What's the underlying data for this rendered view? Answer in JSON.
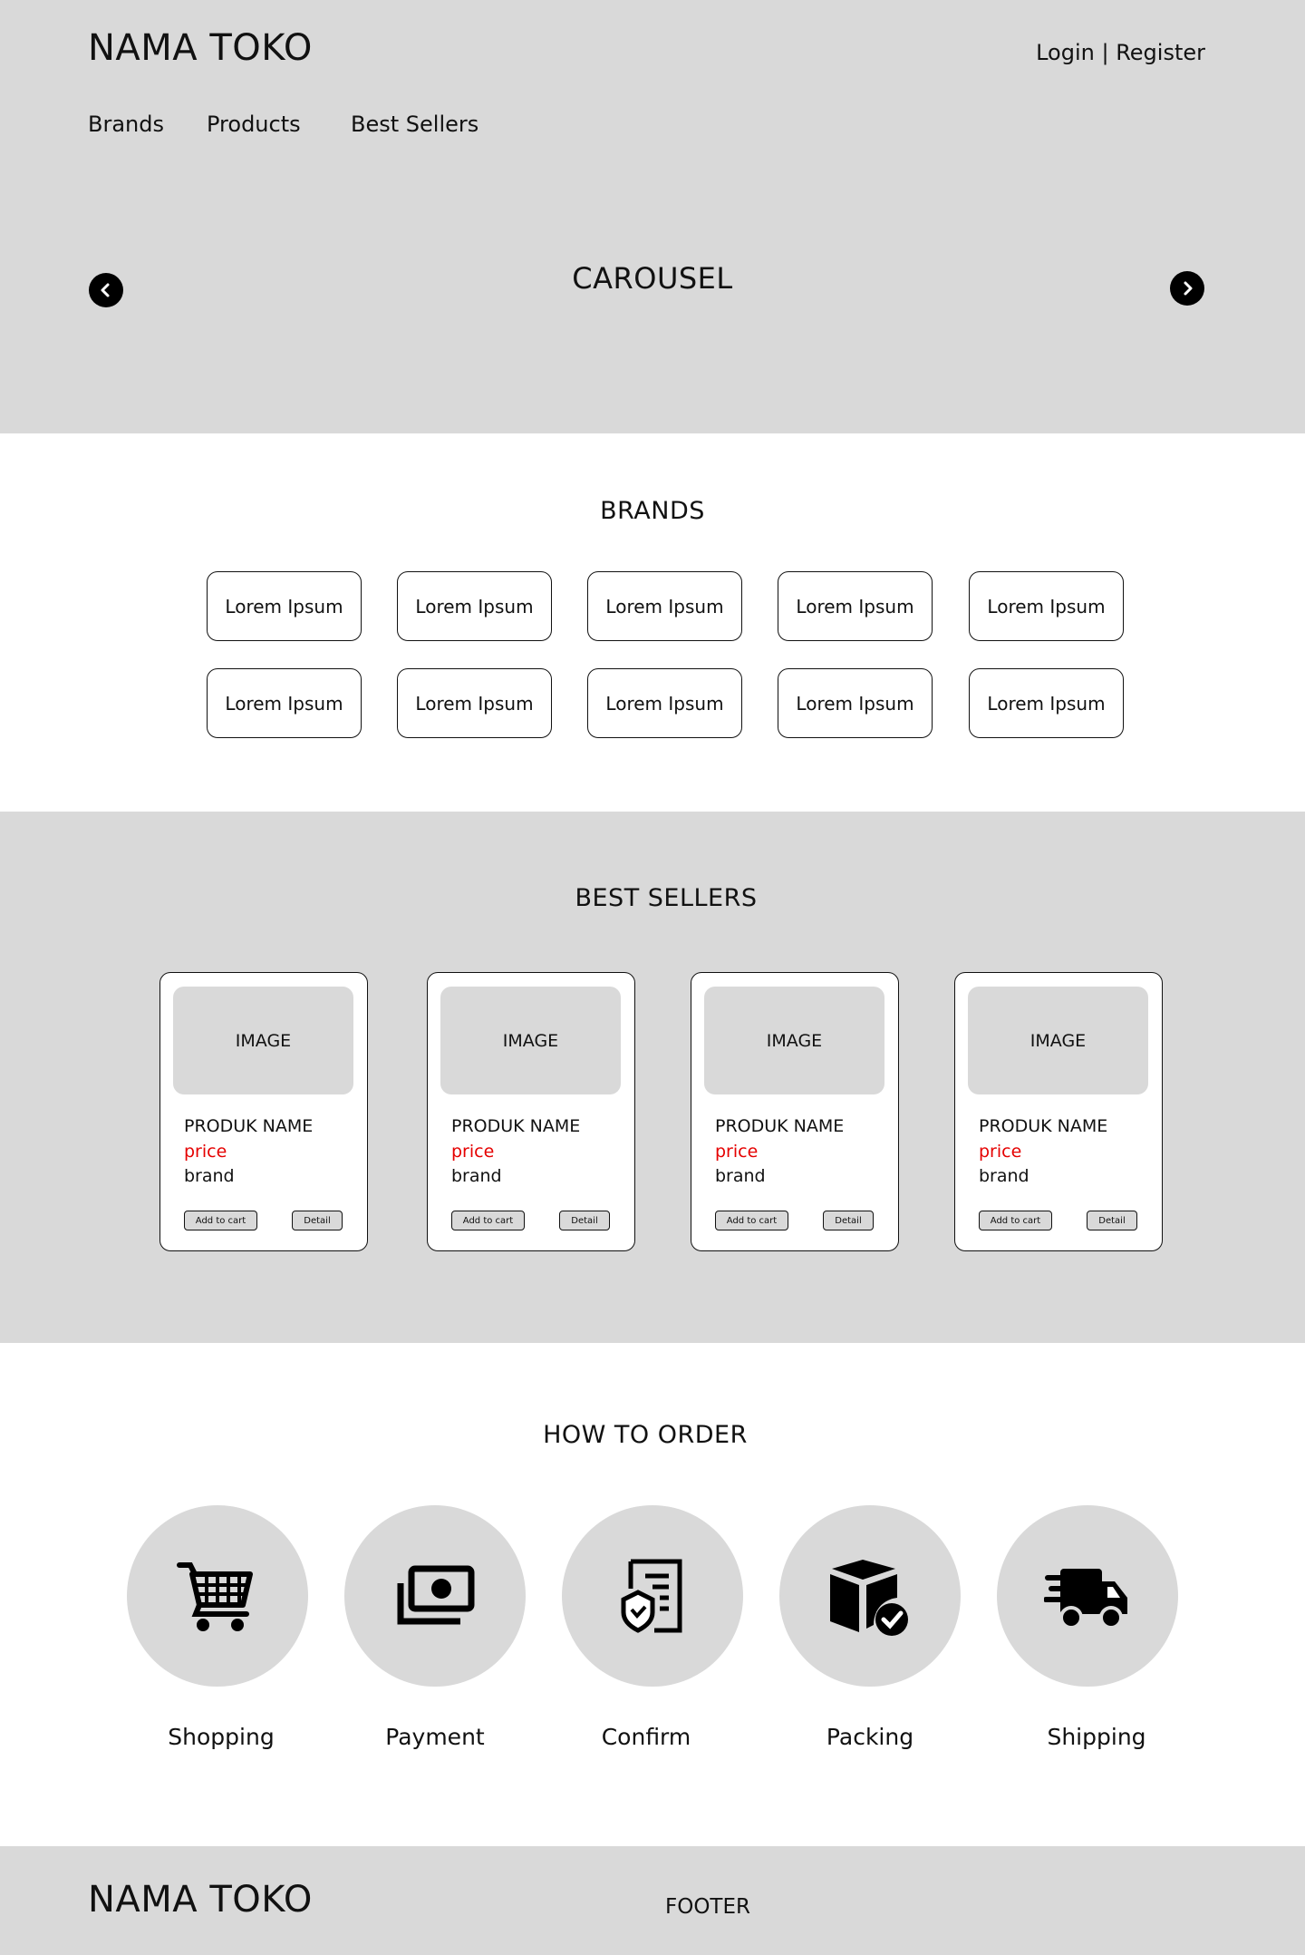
{
  "header": {
    "logo": "NAMA TOKO",
    "login_label": "Login",
    "separator": " | ",
    "register_label": "Register",
    "nav": [
      {
        "label": "Brands"
      },
      {
        "label": "Products"
      },
      {
        "label": "Best Sellers"
      }
    ]
  },
  "carousel": {
    "title": "CAROUSEL",
    "prev_icon": "chevron-left-icon",
    "next_icon": "chevron-right-icon"
  },
  "brands": {
    "title": "BRANDS",
    "items": [
      {
        "label": "Lorem Ipsum"
      },
      {
        "label": "Lorem Ipsum"
      },
      {
        "label": "Lorem Ipsum"
      },
      {
        "label": "Lorem Ipsum"
      },
      {
        "label": "Lorem Ipsum"
      },
      {
        "label": "Lorem Ipsum"
      },
      {
        "label": "Lorem Ipsum"
      },
      {
        "label": "Lorem Ipsum"
      },
      {
        "label": "Lorem Ipsum"
      },
      {
        "label": "Lorem Ipsum"
      }
    ]
  },
  "bestsellers": {
    "title": "BEST SELLERS",
    "cards": [
      {
        "image": "IMAGE",
        "name": "PRODUK NAME",
        "price": "price",
        "brand": "brand",
        "add_label": "Add to cart",
        "detail_label": "Detail"
      },
      {
        "image": "IMAGE",
        "name": "PRODUK NAME",
        "price": "price",
        "brand": "brand",
        "add_label": "Add to cart",
        "detail_label": "Detail"
      },
      {
        "image": "IMAGE",
        "name": "PRODUK NAME",
        "price": "price",
        "brand": "brand",
        "add_label": "Add to cart",
        "detail_label": "Detail"
      },
      {
        "image": "IMAGE",
        "name": "PRODUK NAME",
        "price": "price",
        "brand": "brand",
        "add_label": "Add to cart",
        "detail_label": "Detail"
      }
    ],
    "price_color": "#e50000"
  },
  "howto": {
    "title": "HOW TO ORDER",
    "steps": [
      {
        "label": "Shopping",
        "icon": "shopping-cart-icon"
      },
      {
        "label": "Payment",
        "icon": "money-icon"
      },
      {
        "label": "Confirm",
        "icon": "document-shield-icon"
      },
      {
        "label": "Packing",
        "icon": "package-check-icon"
      },
      {
        "label": "Shipping",
        "icon": "delivery-truck-icon"
      }
    ]
  },
  "footer": {
    "logo": "NAMA TOKO",
    "text": "FOOTER"
  },
  "colors": {
    "panel_gray": "#d9d9d9",
    "text": "#111111",
    "accent_red": "#e50000"
  }
}
